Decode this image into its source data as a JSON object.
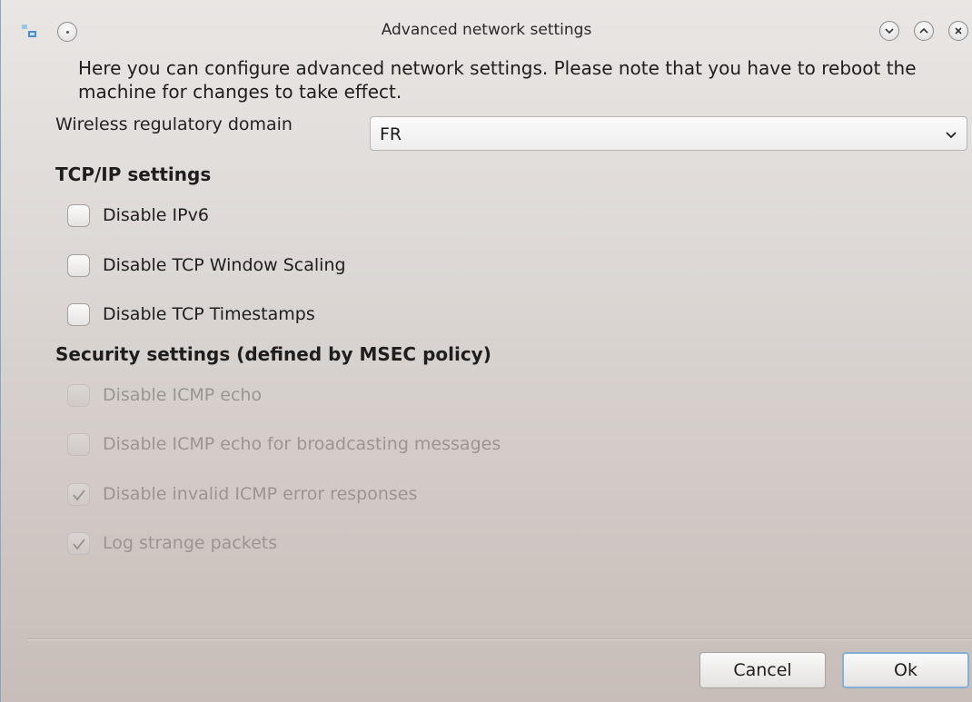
{
  "window": {
    "title": "Advanced network settings"
  },
  "intro_text": "Here you can configure advanced network settings. Please note that you have to reboot the machine for changes to take effect.",
  "regulatory": {
    "label": "Wireless regulatory domain",
    "value": "FR"
  },
  "tcpip": {
    "heading": "TCP/IP settings",
    "options": [
      {
        "label": "Disable IPv6",
        "checked": false,
        "enabled": true
      },
      {
        "label": "Disable TCP Window Scaling",
        "checked": false,
        "enabled": true
      },
      {
        "label": "Disable TCP Timestamps",
        "checked": false,
        "enabled": true
      }
    ]
  },
  "security": {
    "heading": "Security settings (defined by MSEC policy)",
    "options": [
      {
        "label": "Disable ICMP echo",
        "checked": false,
        "enabled": false
      },
      {
        "label": "Disable ICMP echo for broadcasting messages",
        "checked": false,
        "enabled": false
      },
      {
        "label": "Disable invalid ICMP error responses",
        "checked": true,
        "enabled": false
      },
      {
        "label": "Log strange packets",
        "checked": true,
        "enabled": false
      }
    ]
  },
  "buttons": {
    "cancel": "Cancel",
    "ok": "Ok"
  },
  "icons": {
    "app": "network-icon",
    "sticky": "sticky-dot-icon",
    "minimize": "chevron-down-icon",
    "maximize": "chevron-up-icon",
    "close": "close-icon",
    "dropdown": "chevron-down-icon",
    "check": "checkmark-icon"
  }
}
